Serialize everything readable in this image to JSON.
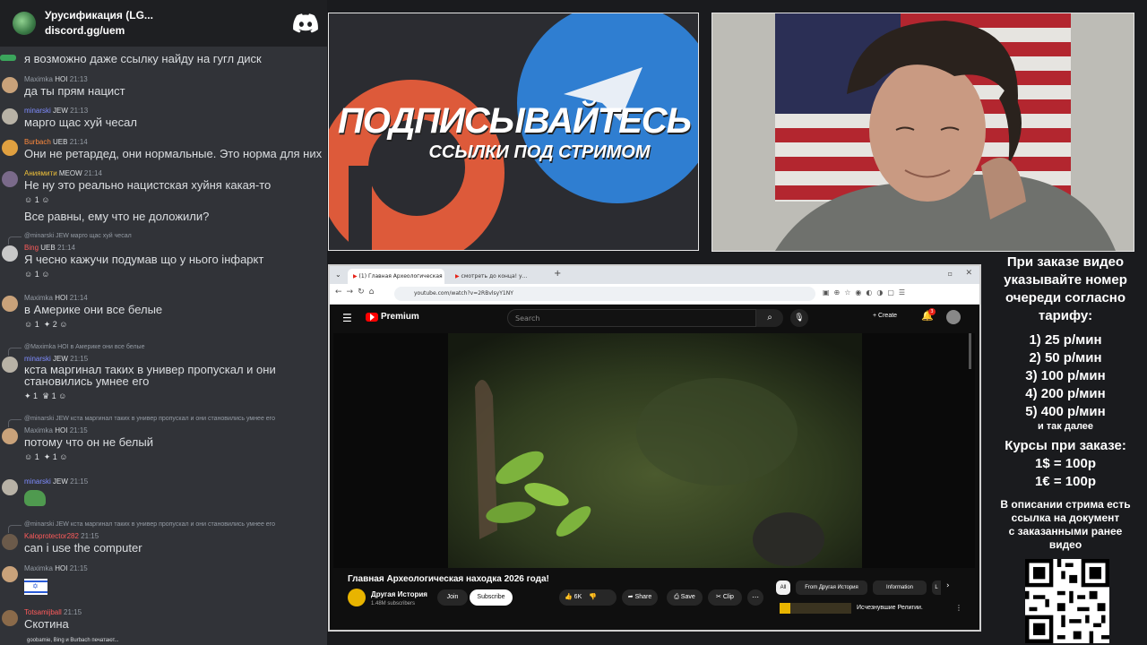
{
  "chat": {
    "server_name": "Урусификация (LG...",
    "server_invite": "discord.gg/uem",
    "top_fragment": "я возможно даже ссылку найду на гугл диск",
    "messages": [
      {
        "user": "Maximka",
        "badge": "HOI",
        "time": "21:13",
        "text": "да ты прям нацист",
        "ucolor": "#949ba4"
      },
      {
        "user": "minarski",
        "badge": "JEW",
        "time": "21:13",
        "text": "марго щас хуй чесал",
        "ucolor": "#7f8cff"
      },
      {
        "user": "Burbach",
        "badge": "UEB",
        "time": "21:14",
        "text": "Они не ретардед, они нормальные. Это норма для них",
        "ucolor": "#ff8a3d"
      },
      {
        "user": "Аниямити",
        "badge": "MEOW",
        "time": "21:14",
        "text": "Не ну это реально нацистская хуйня какая-то",
        "text2": "Все равны, ему что не доложили?",
        "react": "1",
        "ucolor": "#f0c23a"
      },
      {
        "reply_user": "@minarski",
        "reply_badge": "JEW",
        "reply_text": "марго щас хуй чесал",
        "user": "Bing",
        "badge": "UEB",
        "time": "21:14",
        "text": "Я чесно кажучи подумав що у нього інфаркт",
        "react": "1",
        "ucolor": "#ff5b5b"
      },
      {
        "user": "Maximka",
        "badge": "HOI",
        "time": "21:14",
        "text": "в Америке они все белые",
        "react": "1",
        "react2": "2",
        "ucolor": "#949ba4"
      },
      {
        "reply_user": "@Maximka",
        "reply_badge": "HOI",
        "reply_text": "в Америке они все белые",
        "user": "minarski",
        "badge": "JEW",
        "time": "21:15",
        "text": "кста маргинал таких в универ пропускал и они",
        "text2": "становились умнее его",
        "react": "1",
        "react2": "1",
        "ucolor": "#7f8cff"
      },
      {
        "reply_user": "@minarski",
        "reply_badge": "JEW",
        "reply_text": "кста маргинал таких в универ пропускал и они становились умнее его",
        "user": "Maximka",
        "badge": "HOI",
        "time": "21:15",
        "text": "потому что он не белый",
        "react": "1",
        "react2": "1",
        "ucolor": "#949ba4"
      },
      {
        "user": "minarski",
        "badge": "JEW",
        "time": "21:15",
        "ucolor": "#7f8cff"
      },
      {
        "reply_user": "@minarski",
        "reply_badge": "JEW",
        "reply_text": "кста маргинал таких в универ пропускал и они становились умнее его",
        "user": "Kaloprotector282",
        "time": "21:15",
        "text": "can i use the computer",
        "ucolor": "#ff5b5b"
      },
      {
        "user": "Maximka",
        "badge": "HOI",
        "time": "21:15",
        "ucolor": "#949ba4"
      },
      {
        "user": "Totsamijball",
        "time": "21:15",
        "text": "Скотина",
        "ucolor": "#ff5b5b"
      }
    ],
    "typing": "goobamie, Bing и Burbach печатают..."
  },
  "promo": {
    "line1": "ПОДПИСЫВАЙТЕСЬ",
    "line2": "ССЫЛКИ ПОД СТРИМОМ"
  },
  "browser": {
    "tab1": "(1) Главная Археологическая",
    "tab2": "смотреть до конца! у...",
    "url": "youtube.com/watch?v=2RBvlsyY1NY",
    "yt_logo": "Premium",
    "search_placeholder": "Search",
    "create_label": "Create",
    "notif_count": "3",
    "video_title": "Главная Археологическая находка 2026 года!",
    "channel_name": "Другая История",
    "subscribers": "1.48M subscribers",
    "join_label": "Join",
    "subscribe_label": "Subscribe",
    "likes": "6K",
    "share_label": "Share",
    "save_label": "Save",
    "clip_label": "Clip",
    "chips": [
      "All",
      "From Другая История",
      "Information",
      "L"
    ],
    "rec_title": "Исчезнувшие Религии."
  },
  "side_info": {
    "intro": [
      "При заказе видео",
      "указывайте номер",
      "очереди согласно",
      "тарифу:"
    ],
    "prices": [
      "1) 25 р/мин",
      "2) 50 р/мин",
      "3) 100 р/мин",
      "4) 200 р/мин",
      "5) 400 р/мин"
    ],
    "etc": "и так далее",
    "rates_title": "Курсы при заказе:",
    "rates": [
      "1$ = 100р",
      "1€ = 100р"
    ],
    "note": [
      "В описании стрима есть",
      "ссылка на документ",
      "с заказанными ранее",
      "видео"
    ]
  }
}
